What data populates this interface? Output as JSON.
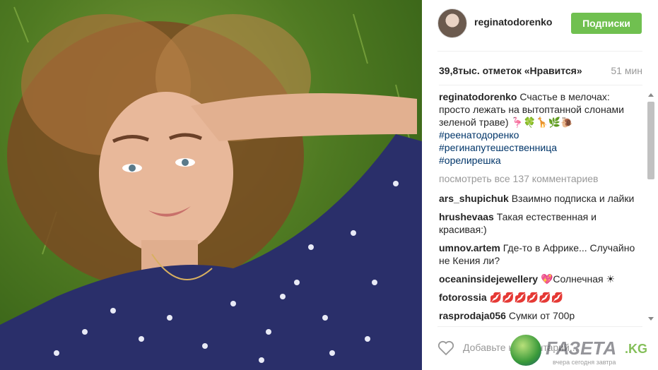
{
  "header": {
    "username": "reginatodorenko",
    "follow_label": "Подписки"
  },
  "likes": {
    "count_text": "39,8тыс. отметок «Нравится»",
    "time": "51 мин"
  },
  "caption": {
    "user": "reginatodorenko",
    "text": "Счастье в мелочах: просто лежать на вытоптанной слонами зеленой траве) 🦩🍀🦒🌿🐌",
    "hashtags": [
      "#реенатодоренко",
      "#регинапутешественница",
      "#орелирешка"
    ]
  },
  "view_all": "посмотреть все 137 комментариев",
  "comments": [
    {
      "user": "ars_shupichuk",
      "text": "Взаимно подписка и лайки"
    },
    {
      "user": "hrushevaas",
      "text": "Такая естественная и красивая:)"
    },
    {
      "user": "umnov.artem",
      "text": "Где-то в Африке... Случайно не Кения ли?"
    },
    {
      "user": "oceaninsidejewellery",
      "text": "💖Солнечная ☀"
    },
    {
      "user": "fotorossia",
      "text": "💋💋💋💋💋💋"
    },
    {
      "user": "rasprodaja056",
      "text": "Сумки от 700р"
    }
  ],
  "footer": {
    "add_comment_placeholder": "Добавьте комментарий..."
  },
  "watermark": {
    "brand": "ГАЗЕТА",
    "domain": ".KG",
    "tagline": "вчера сегодня завтра"
  },
  "colors": {
    "follow_button": "#70c050",
    "hashtag": "#003569",
    "muted": "#999999"
  }
}
